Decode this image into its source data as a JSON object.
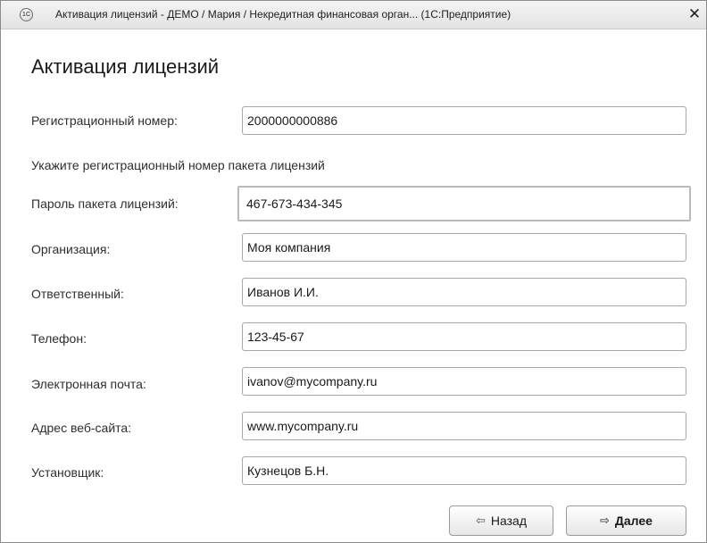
{
  "window": {
    "icon": "1c-app-icon",
    "title": "Активация лицензий - ДЕМО / Мария / Некредитная финансовая орган... (1С:Предприятие)",
    "close_label": "✕"
  },
  "form": {
    "title": "Активация лицензий",
    "reg_number": {
      "label": "Регистрационный номер:",
      "value": "2000000000886"
    },
    "hint": "Укажите регистрационный номер пакета лицензий",
    "password": {
      "label": "Пароль пакета лицензий:",
      "value": "467-673-434-345"
    },
    "organization": {
      "label": "Организация:",
      "value": "Моя компания"
    },
    "responsible": {
      "label": "Ответственный:",
      "value": "Иванов И.И."
    },
    "phone": {
      "label": "Телефон:",
      "value": "123-45-67"
    },
    "email": {
      "label": "Электронная почта:",
      "value": "ivanov@mycompany.ru"
    },
    "website": {
      "label": "Адрес веб-сайта:",
      "value": "www.mycompany.ru"
    },
    "installer": {
      "label": "Установщик:",
      "value": "Кузнецов Б.Н."
    }
  },
  "buttons": {
    "back": {
      "label": "Назад",
      "icon": "arrow-left-icon"
    },
    "next": {
      "label": "Далее",
      "icon": "arrow-right-icon"
    }
  }
}
